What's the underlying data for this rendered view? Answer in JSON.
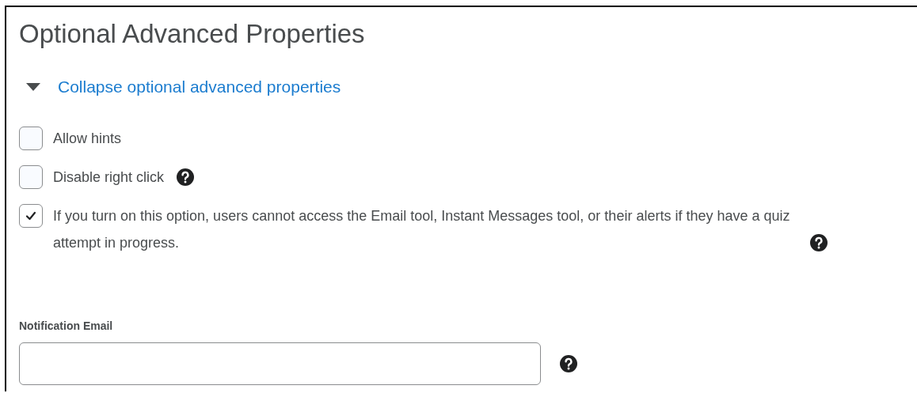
{
  "title": "Optional Advanced Properties",
  "toggle": {
    "label": "Collapse optional advanced properties",
    "expanded": true
  },
  "options": [
    {
      "label": "Allow hints",
      "checked": false,
      "help": false
    },
    {
      "label": "Disable right click",
      "checked": false,
      "help": true
    },
    {
      "label": "If you turn on this option, users cannot access the Email tool, Instant Messages tool, or their alerts if they have a quiz attempt in progress.",
      "checked": true,
      "help": true
    }
  ],
  "notification_email": {
    "label": "Notification Email",
    "help": true
  }
}
